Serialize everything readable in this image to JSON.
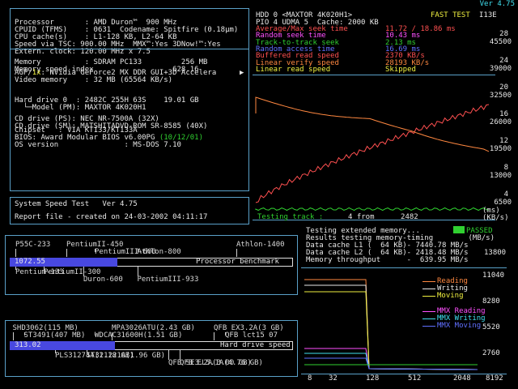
{
  "version": "Ver 4.75",
  "sysinfo": {
    "lines": [
      "Processor       : AMD Duron™  900 MHz",
      "CPUID (TFMS)    : 0631  Codename: Spitfire (0.18µm)",
      "CPU cache(s)    : L1-128 KB, L2-64 KB",
      "Speed via TSC: 900.00 MHz  MMX™:Yes 3DNow!™:Yes",
      "Extern. clock: 120.00 MHz x 7.5"
    ],
    "mem_lines": [
      "Memory          : SDRAM PC133         256 MB",
      "Memory speed index                  628.16"
    ],
    "agp_prefix": "AGP/",
    "agp_rate": "1x",
    "agp_rest": ": NVidia GeForce2 MX DDR GUI+3D Accelera",
    "video_line": "Video memory    : 32 MB (65564 KB/s)",
    "hd_lines": [
      "Hard drive 0  : 2482C 255H 63S    19.01 GB",
      "  └─Model (PM): MAXTOR 4K020H1"
    ],
    "cd_lines": [
      "CD drive (PS): NEC NR-7500A (32X)",
      "CD drive (SM): MATSHITADVD-ROM SR-8585 (40X)"
    ],
    "chipset_line": "Chipset   : VIA KT133/KT133A",
    "bios_prefix": "BIOS: Award Modular BIOS v6.00PG ",
    "bios_date": "(10/12/01)",
    "os_line": "OS version               : MS-DOS 7.10"
  },
  "speedtest": {
    "title": "System Speed Test   Ver 4.75",
    "report": "Report file - created on 24-03-2002 04:11:17"
  },
  "proc_bench": {
    "value": "1072.55",
    "label": "Processor benchmark",
    "fill_fraction": 0.38,
    "top_labels": [
      {
        "text": "P55C-233",
        "pos": 0.02
      },
      {
        "text": "PentiumIII-600",
        "pos": 0.3
      },
      {
        "text": "PentiumII-450",
        "pos": 0.2
      },
      {
        "text": "Athlon-800",
        "pos": 0.45
      },
      {
        "text": "Athlon-1400",
        "pos": 0.8
      }
    ],
    "bottom_labels": [
      {
        "text": "PentiumII-300",
        "pos": 0.12
      },
      {
        "text": "PentiumIII-933",
        "pos": 0.45
      },
      {
        "text": "Pentium-133",
        "pos": 0.02
      },
      {
        "text": "Duron-600",
        "pos": 0.26
      }
    ]
  },
  "hd_bench": {
    "value": "313.02",
    "label": "Hard drive speed",
    "fill_fraction": 0.37,
    "top_labels": [
      {
        "text": "SHD3062(115 MB)",
        "pos": 0.01
      },
      {
        "text": "WDCAC31600H(1.51 GB)",
        "pos": 0.3
      },
      {
        "text": "QFB EX3.2A(3 GB)",
        "pos": 0.72
      },
      {
        "text": "ST3491(407 MB)",
        "pos": 0.05
      },
      {
        "text": "MPA3026ATU(2.43 GB)",
        "pos": 0.36
      },
      {
        "text": "QFB lct15 07",
        "pos": 0.76
      }
    ],
    "bottom_labels": [
      {
        "text": "ST321221A(1.96 GB)",
        "pos": 0.27
      },
      {
        "text": "QFB EL5.1A(4.76 GB)",
        "pos": 0.6
      },
      {
        "text": "PLS31274A(1.18 GB)",
        "pos": 0.16
      },
      {
        "text": "QFB SE3.2A(3.00 GB)",
        "pos": 0.56
      }
    ]
  },
  "hdd": {
    "header1": "HDD 0 <MAXTOR 4K020H1>",
    "fast_test": "FAST TEST",
    "i13e": "I13E",
    "header2": "PIO 4 UDMA 5  Cache: 2000 KB",
    "stats": [
      {
        "label": "Average/Max seek time",
        "value": "11.72 / 18.86 ms",
        "color": "#ff5050"
      },
      {
        "label": "Random seek time     ",
        "value": "10.43 ms",
        "color": "#ff50ff"
      },
      {
        "label": "Track-to-track seek  ",
        "value": "2.13 ms",
        "color": "#30d030"
      },
      {
        "label": "Random access time   ",
        "value": "16.69 ms",
        "color": "#6070ff"
      },
      {
        "label": "Buffered read speed  ",
        "value": "2370 KB/s",
        "color": "#ff5050"
      },
      {
        "label": "Linear verify speed  ",
        "value": "28193 KB/s",
        "color": "#ff8840"
      },
      {
        "label": "Linear read speed    ",
        "value": "Skipped",
        "color": "#f0f040"
      }
    ],
    "right_axis": [
      "28",
      "45500",
      "24",
      "39000",
      "20",
      "32500",
      "16",
      "26000",
      "12",
      "19500",
      "8",
      "13000",
      "4",
      "6500"
    ],
    "testing_track_label": "Testing track :",
    "testing_track_value": "4 from      2482",
    "ms_unit": "(ms)",
    "kbs_unit": "(KB/s)"
  },
  "cache": {
    "line1": "Testing extended memory...",
    "passed": "PASSED",
    "line2": "Results testing memory-timing        (MB/s)",
    "line3": "Data cache L1 (  64 KB)- 7440.78 MB/s",
    "line4": "Data cache L2 (  64 KB)- 2418.48 MB/s",
    "line5": "Memory throughput      -  639.95 MB/s",
    "right_top": "13800",
    "y_axis": [
      "11040",
      "8280",
      "5520",
      "2760"
    ],
    "x_axis": [
      "8",
      "32",
      "128",
      "512",
      "2048",
      "8192"
    ],
    "legend": [
      {
        "text": "Reading",
        "color": "#ff8840"
      },
      {
        "text": "Writing",
        "color": "#e8e8e8"
      },
      {
        "text": "Moving",
        "color": "#f0f040"
      },
      {
        "text": "MMX Reading",
        "color": "#ff50ff"
      },
      {
        "text": "MMX Writing",
        "color": "#40e0f0"
      },
      {
        "text": "MMX Moving",
        "color": "#6070ff"
      }
    ]
  }
}
